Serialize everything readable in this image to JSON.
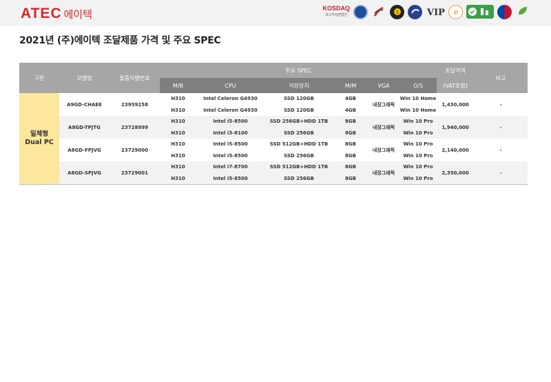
{
  "header": {
    "logo_text": "ATEC",
    "logo_sub": "에이텍",
    "badges": [
      "KOSDAQ 코스닥상장법인"
    ],
    "badge_kosdaq": "KOSDAQ",
    "badge_kosdaq_sub": "코스닥상장법인"
  },
  "title": "2021년 (주)에이텍 조달제품 가격 및 주요 SPEC",
  "table": {
    "h_category": "구분",
    "h_model": "모델명",
    "h_product_id": "물품식별번호",
    "h_spec": "주요 SPEC",
    "h_price": "조달가격",
    "h_price_vat": "(VAT포함)",
    "h_note": "비고",
    "sub_headers": [
      "M/B",
      "CPU",
      "저장장치",
      "M/M",
      "VGA",
      "O/S"
    ],
    "category": "일체형 Dual PC",
    "category_line1": "일체형",
    "category_line2": "Dual PC",
    "models": [
      {
        "model": "A9GD-CHAEE",
        "id": "23959258",
        "vga": "내장그래픽",
        "price": "1,430,000",
        "note": "-",
        "rows": [
          {
            "mb": "H310",
            "cpu": "Intel Celeron G4930",
            "storage": "SSD 120GB",
            "mm": "4GB",
            "os": "Win 10 Home"
          },
          {
            "mb": "H310",
            "cpu": "Intel Celeron G4930",
            "storage": "SSD 120GB",
            "mm": "4GB",
            "os": "Win 10 Home"
          }
        ]
      },
      {
        "model": "A8GD-TPJTG",
        "id": "23728999",
        "vga": "내장그래픽",
        "price": "1,940,000",
        "note": "-",
        "rows": [
          {
            "mb": "H310",
            "cpu": "Intel i5-8500",
            "storage": "SSD 256GB+HDD 1TB",
            "mm": "8GB",
            "os": "Win 10 Pro"
          },
          {
            "mb": "H310",
            "cpu": "Intel i3-8100",
            "storage": "SSD 256GB",
            "mm": "8GB",
            "os": "Win 10 Pro"
          }
        ]
      },
      {
        "model": "A8GD-FPJVG",
        "id": "23729000",
        "vga": "내장그래픽",
        "price": "2,140,000",
        "note": "-",
        "rows": [
          {
            "mb": "H310",
            "cpu": "Intel i5-8500",
            "storage": "SSD 512GB+HDD 1TB",
            "mm": "8GB",
            "os": "Win 10 Pro"
          },
          {
            "mb": "H310",
            "cpu": "Intel i5-8500",
            "storage": "SSD 256GB",
            "mm": "8GB",
            "os": "Win 10 Pro"
          }
        ]
      },
      {
        "model": "A8GD-SPJVG",
        "id": "23729001",
        "vga": "내장그래픽",
        "price": "2,350,000",
        "note": "-",
        "rows": [
          {
            "mb": "H310",
            "cpu": "Intel i7-8700",
            "storage": "SSD 512GB+HDD 1TB",
            "mm": "8GB",
            "os": "Win 10 Pro"
          },
          {
            "mb": "H310",
            "cpu": "Intel i5-8500",
            "storage": "SSD 256GB",
            "mm": "8GB",
            "os": "Win 10 Pro"
          }
        ]
      }
    ]
  }
}
